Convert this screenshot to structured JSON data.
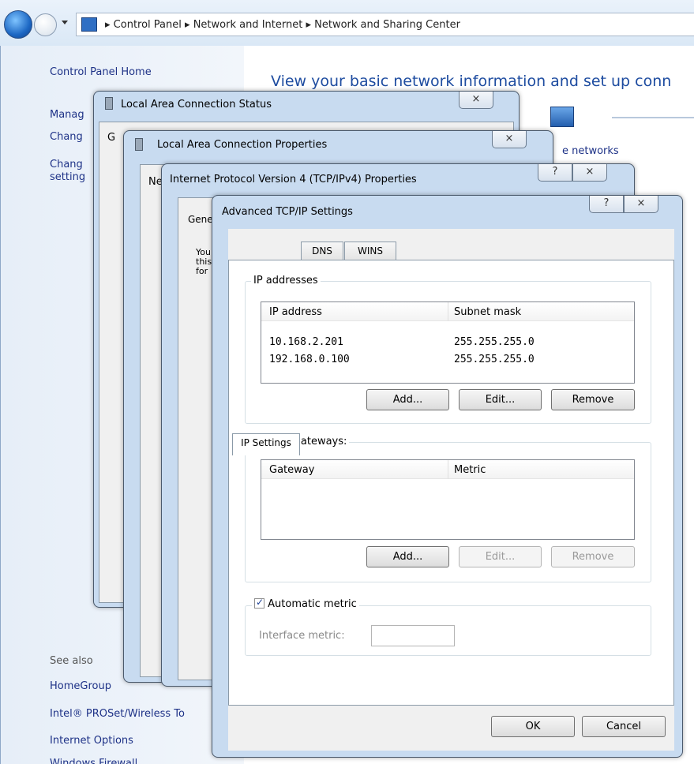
{
  "explorer": {
    "breadcrumb": [
      "Control Panel",
      "Network and Internet",
      "Network and Sharing Center"
    ],
    "nav": {
      "home": "Control Panel Home",
      "manage": "Manag",
      "change1": "Chang",
      "change2a": "Chang",
      "change2b": "setting",
      "see_also": "See also",
      "homegroup": "HomeGroup",
      "intel": "Intel® PROSet/Wireless To",
      "internet_options": "Internet Options",
      "windows_firewall": "Windows Firewall"
    },
    "heading": "View your basic network information and set up conn",
    "networks_label": "e networks"
  },
  "win_status": {
    "title": "Local Area Connection Status",
    "tab_fragment": "G"
  },
  "win_props": {
    "title": "Local Area Connection Properties",
    "tab_fragment": "Ne"
  },
  "win_ipv4": {
    "title": "Internet Protocol Version 4 (TCP/IPv4) Properties",
    "tab_fragment": "Gene",
    "text_fragment": [
      "You",
      "this",
      "for"
    ],
    "help": "?"
  },
  "advanced": {
    "title": "Advanced TCP/IP Settings",
    "help": "?",
    "close": "×",
    "tabs": [
      "IP Settings",
      "DNS",
      "WINS"
    ],
    "ip_group": {
      "label": "IP addresses",
      "columns": [
        "IP address",
        "Subnet mask"
      ],
      "rows": [
        {
          "ip": "10.168.2.201",
          "mask": "255.255.255.0"
        },
        {
          "ip": "192.168.0.100",
          "mask": "255.255.255.0"
        }
      ],
      "buttons": [
        "Add...",
        "Edit...",
        "Remove"
      ]
    },
    "gateway_group": {
      "label": "Default gateways:",
      "columns": [
        "Gateway",
        "Metric"
      ],
      "buttons": [
        "Add...",
        "Edit...",
        "Remove"
      ]
    },
    "metric": {
      "checkbox_label": "Automatic metric",
      "checked": true,
      "field_label": "Interface metric:",
      "value": ""
    },
    "ok": "OK",
    "cancel": "Cancel"
  }
}
